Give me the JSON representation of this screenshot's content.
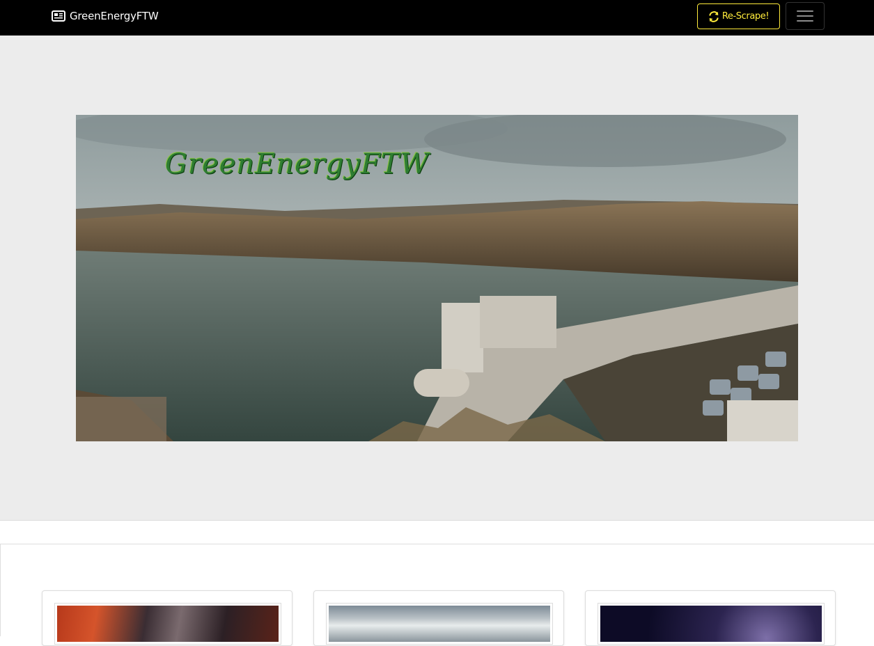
{
  "navbar": {
    "brand": "GreenEnergyFTW",
    "brand_icon": "newspaper-icon",
    "rescrape_label": "Re-Scrape!",
    "rescrape_icon": "sync-icon",
    "toggler_icon": "hamburger-menu-icon",
    "accent_color": "#ffeb3b"
  },
  "hero": {
    "image_alt": "hydroelectric dam over lake with hills",
    "logo_text": "GreenEnergyFTW"
  },
  "cards": [
    {
      "thumb_desc": "red and dark abstract image"
    },
    {
      "thumb_desc": "cloudy sky image"
    },
    {
      "thumb_desc": "night sky purple image"
    }
  ]
}
